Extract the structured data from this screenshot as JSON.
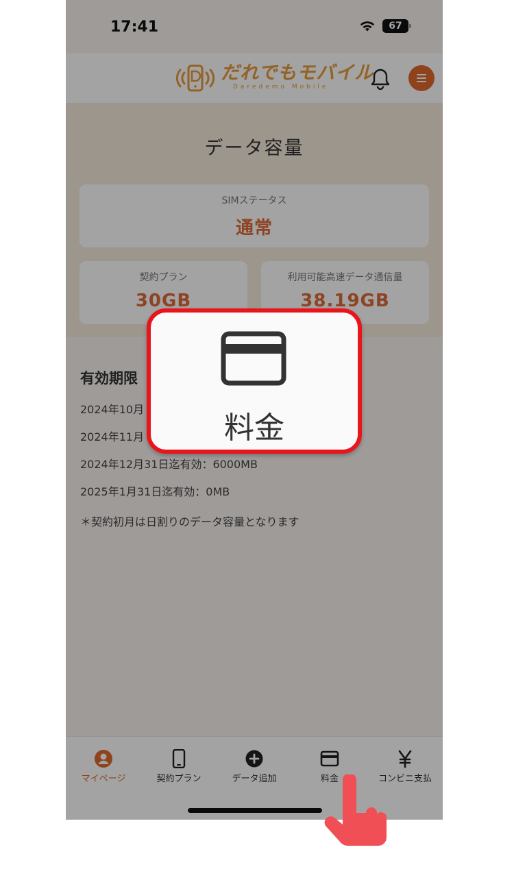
{
  "status_bar": {
    "time": "17:41",
    "battery": "67"
  },
  "header": {
    "logo_main": "だれでもモバイル",
    "logo_sub": "Daredemo Mobile"
  },
  "page_title": "データ容量",
  "sim_card": {
    "label": "SIMステータス",
    "value": "通常"
  },
  "plan_card": {
    "label": "契約プラン",
    "value": "30GB"
  },
  "speed_card": {
    "label": "利用可能高速データ通信量",
    "value": "38.19GB"
  },
  "validity": {
    "title": "有効期限",
    "rows": [
      "2024年10月",
      "2024年11月",
      "2024年12月31日迄有効：6000MB",
      "2025年1月31日迄有効：0MB"
    ],
    "note": "＊契約初月は日割りのデータ容量となります"
  },
  "tabs": [
    {
      "label": "マイページ",
      "icon": "person-icon",
      "active": true
    },
    {
      "label": "契約プラン",
      "icon": "phone-icon",
      "active": false
    },
    {
      "label": "データ追加",
      "icon": "plus-circle-icon",
      "active": false
    },
    {
      "label": "料金",
      "icon": "credit-card-icon",
      "active": false
    },
    {
      "label": "コンビニ支払",
      "icon": "yen-icon",
      "active": false
    }
  ],
  "callout": {
    "label": "料金",
    "icon": "credit-card-icon"
  },
  "colors": {
    "accent": "#e06a2c",
    "highlight": "#e8151b",
    "logo": "#e79a3c",
    "value": "#dd6b3a"
  }
}
